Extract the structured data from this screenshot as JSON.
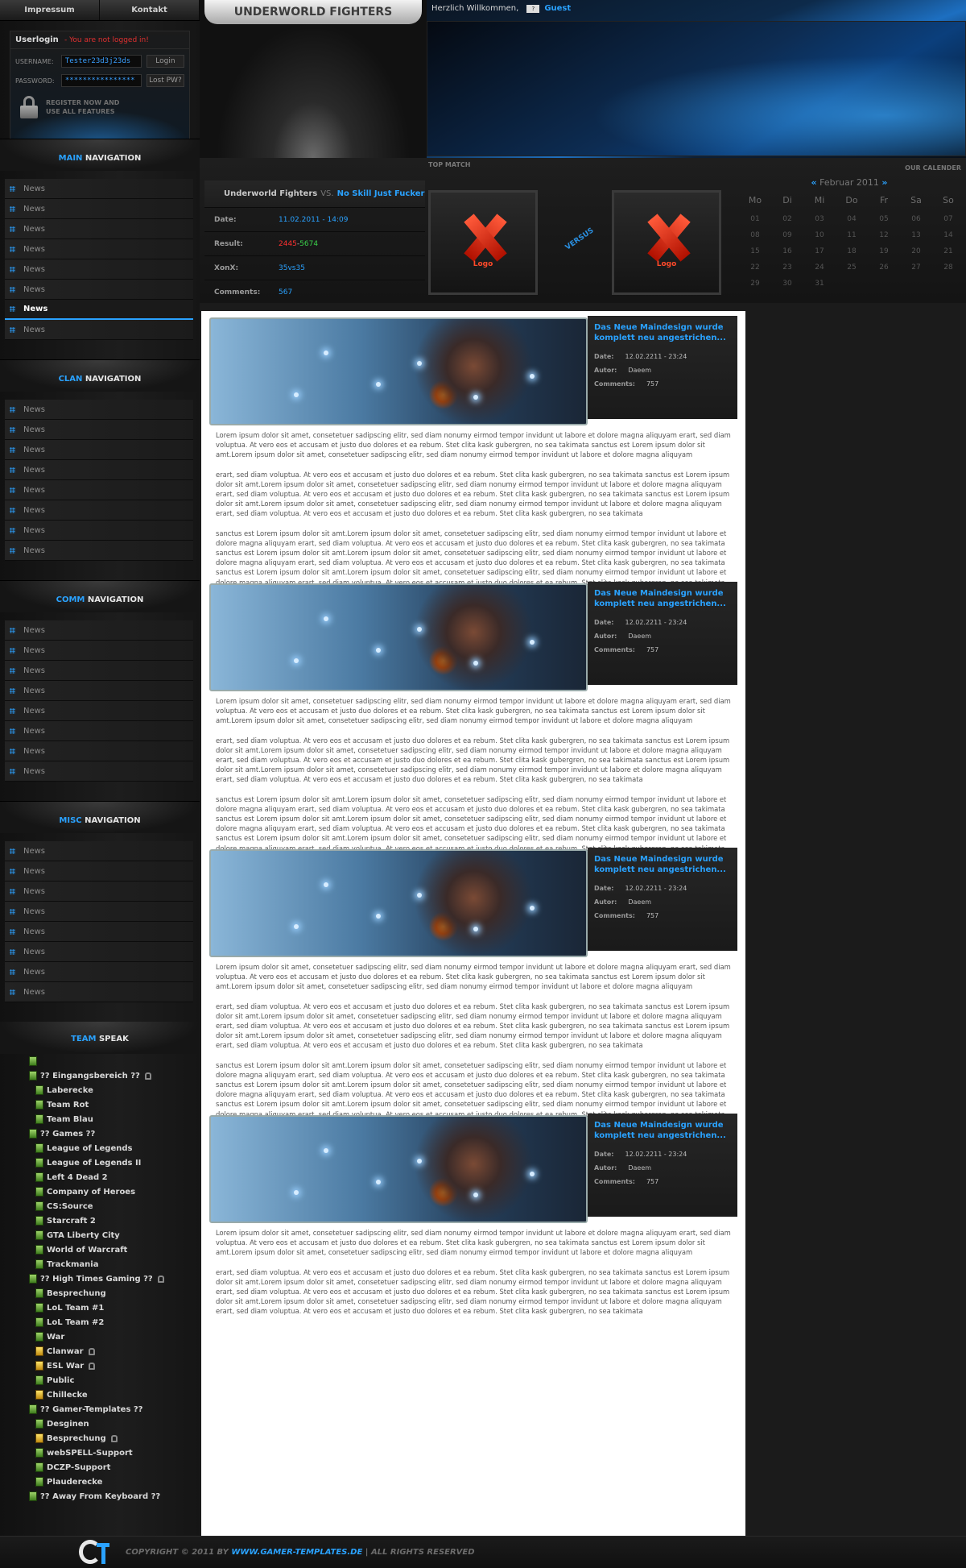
{
  "topnav": {
    "impressum": "Impressum",
    "kontakt": "Kontakt"
  },
  "login": {
    "title": "Userlogin",
    "status": "- You are not logged in!",
    "username_label": "USERNAME:",
    "username_value": "Tester23d3j23ds",
    "login_btn": "Login",
    "password_label": "PASSWORD:",
    "password_value": "****************",
    "lostpw_btn": "Lost PW?",
    "register_line1": "REGISTER NOW AND",
    "register_line2": "USE ALL FEATURES"
  },
  "nav": {
    "main": {
      "hl": "MAIN",
      "rest": " NAVIGATION",
      "items": [
        "News",
        "News",
        "News",
        "News",
        "News",
        "News",
        "News",
        "News"
      ],
      "active": 6
    },
    "clan": {
      "hl": "CLAN",
      "rest": " NAVIGATION",
      "items": [
        "News",
        "News",
        "News",
        "News",
        "News",
        "News",
        "News",
        "News"
      ]
    },
    "comm": {
      "hl": "COMM",
      "rest": " NAVIGATION",
      "items": [
        "News",
        "News",
        "News",
        "News",
        "News",
        "News",
        "News",
        "News"
      ]
    },
    "misc": {
      "hl": "MISC",
      "rest": " NAVIGATION",
      "items": [
        "News",
        "News",
        "News",
        "News",
        "News",
        "News",
        "News",
        "News"
      ]
    }
  },
  "teamspeak": {
    "hl": "TEAM",
    "rest": " SPEAK",
    "channels": [
      {
        "label": "?? Eingangsbereich ??",
        "lvl": 0,
        "lock": true
      },
      {
        "label": "Laberecke",
        "lvl": 1
      },
      {
        "label": "Team Rot",
        "lvl": 1
      },
      {
        "label": "Team Blau",
        "lvl": 1
      },
      {
        "label": "?? Games ??",
        "lvl": 0
      },
      {
        "label": "League of Legends",
        "lvl": 1
      },
      {
        "label": "League of Legends II",
        "lvl": 1
      },
      {
        "label": "Left 4 Dead 2",
        "lvl": 1
      },
      {
        "label": "Company of Heroes",
        "lvl": 1
      },
      {
        "label": "CS:Source",
        "lvl": 1
      },
      {
        "label": "Starcraft 2",
        "lvl": 1
      },
      {
        "label": "GTA Liberty City",
        "lvl": 1
      },
      {
        "label": "World of Warcraft",
        "lvl": 1
      },
      {
        "label": "Trackmania",
        "lvl": 1
      },
      {
        "label": "?? High Times Gaming ??",
        "lvl": 0,
        "lock": true
      },
      {
        "label": "Besprechung",
        "lvl": 1
      },
      {
        "label": "LoL Team #1",
        "lvl": 1
      },
      {
        "label": "LoL Team #2",
        "lvl": 1
      },
      {
        "label": "War",
        "lvl": 1
      },
      {
        "label": "Clanwar",
        "lvl": 1,
        "lock": true,
        "yel": true
      },
      {
        "label": "ESL War",
        "lvl": 1,
        "lock": true,
        "yel": true
      },
      {
        "label": "Public",
        "lvl": 1
      },
      {
        "label": "Chillecke",
        "lvl": 1,
        "yel": true
      },
      {
        "label": "?? Gamer-Templates ??",
        "lvl": 0
      },
      {
        "label": "Desginen",
        "lvl": 1
      },
      {
        "label": "Besprechung",
        "lvl": 1,
        "lock": true,
        "yel": true
      },
      {
        "label": "webSPELL-Support",
        "lvl": 1
      },
      {
        "label": "DCZP-Support",
        "lvl": 1
      },
      {
        "label": "Plauderecke",
        "lvl": 1
      },
      {
        "label": "?? Away From Keyboard ??",
        "lvl": 0
      }
    ]
  },
  "header": {
    "site_title": "UNDERWORLD FIGHTERS",
    "welcome": "Herzlich Willkommen,",
    "flag": "?",
    "guest": "Guest"
  },
  "match": {
    "top_match_label": "TOP MATCH",
    "team1": "Underworld Fighters",
    "vs": "VS.",
    "team2": "No Skill Just Fucker",
    "date_label": "Date:",
    "date_value": "11.02.2011 - 14:09",
    "result_label": "Result:",
    "result_a": "2445",
    "result_sep": " - ",
    "result_b": "5674",
    "xonx_label": "XonX:",
    "xonx_value": "35vs35",
    "comments_label": "Comments:",
    "comments_value": "567",
    "logo_text": "Logo",
    "versus": "VERSUS"
  },
  "calendar": {
    "label": "OUR CALENDER",
    "prev": "«",
    "month": "Februar 2011",
    "next": "»",
    "days": [
      "Mo",
      "Di",
      "Mi",
      "Do",
      "Fr",
      "Sa",
      "So"
    ],
    "dates": [
      "01",
      "02",
      "03",
      "04",
      "05",
      "06",
      "07",
      "08",
      "09",
      "10",
      "11",
      "12",
      "13",
      "14",
      "15",
      "16",
      "17",
      "18",
      "19",
      "20",
      "21",
      "22",
      "23",
      "24",
      "25",
      "26",
      "27",
      "28",
      "29",
      "30",
      "31",
      "",
      "",
      "",
      ""
    ]
  },
  "news": [
    {
      "title": "Das Neue Maindesign wurde komplett neu angestrichen...",
      "date_label": "Date:",
      "date": "12.02.2211 - 23:24",
      "author_label": "Autor:",
      "author": "Daeem",
      "comments_label": "Comments:",
      "comments": "757",
      "paragraphs": [
        "Lorem ipsum dolor sit amet, consetetuer sadipscing elitr, sed diam nonumy eirmod tempor invidunt ut labore et dolore magna aliquyam erart, sed diam voluptua. At vero eos et accusam et justo duo dolores et ea rebum. Stet clita kask gubergren, no sea takimata sanctus est Lorem ipsum dolor sit amt.Lorem ipsum dolor sit amet, consetetuer sadipscing elitr, sed diam nonumy eirmod tempor invidunt ut labore et dolore magna aliquyam",
        "erart, sed diam voluptua. At vero eos et accusam et justo duo dolores et ea rebum. Stet clita kask gubergren, no sea takimata sanctus est Lorem ipsum dolor sit amt.Lorem ipsum dolor sit amet, consetetuer sadipscing elitr, sed diam nonumy eirmod tempor invidunt ut labore et dolore magna aliquyam erart, sed diam voluptua. At vero eos et accusam et justo duo dolores et ea rebum. Stet clita kask gubergren, no sea takimata sanctus est Lorem ipsum dolor sit amt.Lorem ipsum dolor sit amet, consetetuer sadipscing elitr, sed diam nonumy eirmod tempor invidunt ut labore et dolore magna aliquyam erart, sed diam voluptua. At vero eos et accusam et justo duo dolores et ea rebum. Stet clita kask gubergren, no sea takimata",
        "sanctus est Lorem ipsum dolor sit amt.Lorem ipsum dolor sit amet, consetetuer sadipscing elitr, sed diam nonumy eirmod tempor invidunt ut labore et dolore magna aliquyam erart, sed diam voluptua. At vero eos et accusam et justo duo dolores et ea rebum. Stet clita kask gubergren, no sea takimata sanctus est Lorem ipsum dolor sit amt.Lorem ipsum dolor sit amet, consetetuer sadipscing elitr, sed diam nonumy eirmod tempor invidunt ut labore et dolore magna aliquyam erart, sed diam voluptua. At vero eos et accusam et justo duo dolores et ea rebum. Stet clita kask gubergren, no sea takimata sanctus est Lorem ipsum dolor sit amt.Lorem ipsum dolor sit amet, consetetuer sadipscing elitr, sed diam nonumy eirmod tempor invidunt ut labore et dolore magna aliquyam erart, sed diam voluptua. At vero eos et accusam et justo duo dolores et ea rebum. Stet clita kask gubergren, no sea takimata sanctus est Lorem ipsum dolor sit amt.Lorem ipsum dolor sit amet, consetetuer sadipscing elitr, sed diam nonumy eirmod tempor invidunt ut labore et dolore magna aliquyam erart, sed diam voluptua. At vero eos et accusam et justo duo dolores et ea rebum."
      ]
    },
    {
      "title": "Das Neue Maindesign wurde komplett neu angestrichen...",
      "date_label": "Date:",
      "date": "12.02.2211 - 23:24",
      "author_label": "Autor:",
      "author": "Daeem",
      "comments_label": "Comments:",
      "comments": "757",
      "paragraphs": [
        "Lorem ipsum dolor sit amet, consetetuer sadipscing elitr, sed diam nonumy eirmod tempor invidunt ut labore et dolore magna aliquyam erart, sed diam voluptua. At vero eos et accusam et justo duo dolores et ea rebum. Stet clita kask gubergren, no sea takimata sanctus est Lorem ipsum dolor sit amt.Lorem ipsum dolor sit amet, consetetuer sadipscing elitr, sed diam nonumy eirmod tempor invidunt ut labore et dolore magna aliquyam",
        "erart, sed diam voluptua. At vero eos et accusam et justo duo dolores et ea rebum. Stet clita kask gubergren, no sea takimata sanctus est Lorem ipsum dolor sit amt.Lorem ipsum dolor sit amet, consetetuer sadipscing elitr, sed diam nonumy eirmod tempor invidunt ut labore et dolore magna aliquyam erart, sed diam voluptua. At vero eos et accusam et justo duo dolores et ea rebum. Stet clita kask gubergren, no sea takimata sanctus est Lorem ipsum dolor sit amt.Lorem ipsum dolor sit amet, consetetuer sadipscing elitr, sed diam nonumy eirmod tempor invidunt ut labore et dolore magna aliquyam erart, sed diam voluptua. At vero eos et accusam et justo duo dolores et ea rebum. Stet clita kask gubergren, no sea takimata",
        "sanctus est Lorem ipsum dolor sit amt.Lorem ipsum dolor sit amet, consetetuer sadipscing elitr, sed diam nonumy eirmod tempor invidunt ut labore et dolore magna aliquyam erart, sed diam voluptua. At vero eos et accusam et justo duo dolores et ea rebum. Stet clita kask gubergren, no sea takimata sanctus est Lorem ipsum dolor sit amt.Lorem ipsum dolor sit amet, consetetuer sadipscing elitr, sed diam nonumy eirmod tempor invidunt ut labore et dolore magna aliquyam erart, sed diam voluptua. At vero eos et accusam et justo duo dolores et ea rebum. Stet clita kask gubergren, no sea takimata sanctus est Lorem ipsum dolor sit amt.Lorem ipsum dolor sit amet, consetetuer sadipscing elitr, sed diam nonumy eirmod tempor invidunt ut labore et dolore magna aliquyam erart, sed diam voluptua. At vero eos et accusam et justo duo dolores et ea rebum. Stet clita kask gubergren, no sea takimata sanctus est Lorem ipsum dolor sit amt.Lorem ipsum dolor sit amet, consetetuer sadipscing elitr, sed diam nonumy eirmod tempor invidunt ut labore et dolore magna aliquyam erart, sed diam voluptua. At vero eos et accusam et justo duo dolores et ea rebum."
      ]
    },
    {
      "title": "Das Neue Maindesign wurde komplett neu angestrichen...",
      "date_label": "Date:",
      "date": "12.02.2211 - 23:24",
      "author_label": "Autor:",
      "author": "Daeem",
      "comments_label": "Comments:",
      "comments": "757",
      "paragraphs": [
        "Lorem ipsum dolor sit amet, consetetuer sadipscing elitr, sed diam nonumy eirmod tempor invidunt ut labore et dolore magna aliquyam erart, sed diam voluptua. At vero eos et accusam et justo duo dolores et ea rebum. Stet clita kask gubergren, no sea takimata sanctus est Lorem ipsum dolor sit amt.Lorem ipsum dolor sit amet, consetetuer sadipscing elitr, sed diam nonumy eirmod tempor invidunt ut labore et dolore magna aliquyam",
        "erart, sed diam voluptua. At vero eos et accusam et justo duo dolores et ea rebum. Stet clita kask gubergren, no sea takimata sanctus est Lorem ipsum dolor sit amt.Lorem ipsum dolor sit amet, consetetuer sadipscing elitr, sed diam nonumy eirmod tempor invidunt ut labore et dolore magna aliquyam erart, sed diam voluptua. At vero eos et accusam et justo duo dolores et ea rebum. Stet clita kask gubergren, no sea takimata sanctus est Lorem ipsum dolor sit amt.Lorem ipsum dolor sit amet, consetetuer sadipscing elitr, sed diam nonumy eirmod tempor invidunt ut labore et dolore magna aliquyam erart, sed diam voluptua. At vero eos et accusam et justo duo dolores et ea rebum. Stet clita kask gubergren, no sea takimata",
        "sanctus est Lorem ipsum dolor sit amt.Lorem ipsum dolor sit amet, consetetuer sadipscing elitr, sed diam nonumy eirmod tempor invidunt ut labore et dolore magna aliquyam erart, sed diam voluptua. At vero eos et accusam et justo duo dolores et ea rebum. Stet clita kask gubergren, no sea takimata sanctus est Lorem ipsum dolor sit amt.Lorem ipsum dolor sit amet, consetetuer sadipscing elitr, sed diam nonumy eirmod tempor invidunt ut labore et dolore magna aliquyam erart, sed diam voluptua. At vero eos et accusam et justo duo dolores et ea rebum. Stet clita kask gubergren, no sea takimata sanctus est Lorem ipsum dolor sit amt.Lorem ipsum dolor sit amet, consetetuer sadipscing elitr, sed diam nonumy eirmod tempor invidunt ut labore et dolore magna aliquyam erart, sed diam voluptua. At vero eos et accusam et justo duo dolores et ea rebum. Stet clita kask gubergren, no sea takimata sanctus est Lorem ipsum dolor sit amt.Lorem ipsum dolor sit amet, consetetuer sadipscing elitr, sed diam nonumy eirmod tempor invidunt ut labore et dolore magna aliquyam erart, sed diam voluptua. At vero eos et accusam et justo duo dolores et ea rebum."
      ]
    },
    {
      "title": "Das Neue Maindesign wurde komplett neu angestrichen...",
      "date_label": "Date:",
      "date": "12.02.2211 - 23:24",
      "author_label": "Autor:",
      "author": "Daeem",
      "comments_label": "Comments:",
      "comments": "757",
      "paragraphs": [
        "Lorem ipsum dolor sit amet, consetetuer sadipscing elitr, sed diam nonumy eirmod tempor invidunt ut labore et dolore magna aliquyam erart, sed diam voluptua. At vero eos et accusam et justo duo dolores et ea rebum. Stet clita kask gubergren, no sea takimata sanctus est Lorem ipsum dolor sit amt.Lorem ipsum dolor sit amet, consetetuer sadipscing elitr, sed diam nonumy eirmod tempor invidunt ut labore et dolore magna aliquyam",
        "erart, sed diam voluptua. At vero eos et accusam et justo duo dolores et ea rebum. Stet clita kask gubergren, no sea takimata sanctus est Lorem ipsum dolor sit amt.Lorem ipsum dolor sit amet, consetetuer sadipscing elitr, sed diam nonumy eirmod tempor invidunt ut labore et dolore magna aliquyam erart, sed diam voluptua. At vero eos et accusam et justo duo dolores et ea rebum. Stet clita kask gubergren, no sea takimata sanctus est Lorem ipsum dolor sit amt.Lorem ipsum dolor sit amet, consetetuer sadipscing elitr, sed diam nonumy eirmod tempor invidunt ut labore et dolore magna aliquyam erart, sed diam voluptua. At vero eos et accusam et justo duo dolores et ea rebum. Stet clita kask gubergren, no sea takimata"
      ]
    }
  ],
  "footer": {
    "copyright": "COPYRIGHT © 2011 BY ",
    "site": "WWW.GAMER-TEMPLATES.DE",
    "rights": " | ALL RIGHTS RESERVED"
  }
}
